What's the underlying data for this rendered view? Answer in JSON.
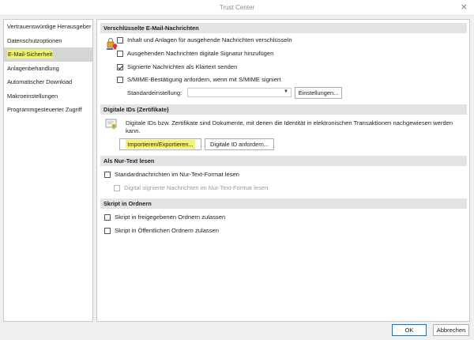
{
  "window": {
    "title": "Trust Center",
    "close_glyph": "×"
  },
  "sidebar": {
    "items": [
      {
        "label": "Vertrauenswürdige Herausgeber"
      },
      {
        "label": "Datenschutzoptionen"
      },
      {
        "label": "E-Mail-Sicherheit"
      },
      {
        "label": "Anlagenbehandlung"
      },
      {
        "label": "Automatischer Download"
      },
      {
        "label": "Makroeinstellungen"
      },
      {
        "label": "Programmgesteuerter Zugriff"
      }
    ],
    "selected_index": 2
  },
  "encrypted": {
    "header": "Verschlüsselte E-Mail-Nachrichten",
    "icon": "lock-certificate-icon",
    "options": [
      {
        "label": "Inhalt und Anlagen für ausgehende Nachrichten verschlüsseln",
        "checked": false
      },
      {
        "label": "Ausgehenden Nachrichten digitale Signatur hinzufügen",
        "checked": false
      },
      {
        "label": "Signierte Nachrichten als Klartext senden",
        "checked": true
      },
      {
        "label": "S/MIME-Bestätigung anfordern, wenn mit S/MIME signiert",
        "checked": false
      }
    ],
    "default_setting_label": "Standardeinstellung:",
    "default_setting_value": "",
    "settings_button": "Einstellungen..."
  },
  "digital_ids": {
    "header": "Digitale IDs (Zertifikate)",
    "icon": "certificate-icon",
    "description": "Digitale IDs bzw. Zertifikate sind Dokumente, mit denen die Identität in elektronischen Transaktionen nachgewiesen werden kann.",
    "import_button": "Importieren/Exportieren...",
    "request_button": "Digitale ID anfordern..."
  },
  "plain_text": {
    "header": "Als Nur-Text lesen",
    "options": [
      {
        "label": "Standardnachrichten im Nur-Text-Format lesen",
        "checked": false,
        "disabled": false
      },
      {
        "label": "Digital signierte Nachrichten im Nur-Text-Format lesen",
        "checked": false,
        "disabled": true
      }
    ]
  },
  "scripts": {
    "header": "Skript in Ordnern",
    "options": [
      {
        "label": "Skript in freigegebenen Ordnern zulassen",
        "checked": false
      },
      {
        "label": "Skript in Öffentlichen Ordnern zulassen",
        "checked": false
      }
    ]
  },
  "footer": {
    "ok": "OK",
    "cancel": "Abbrechen"
  },
  "colors": {
    "highlight": "#f4f36a",
    "selected_bg": "#d5d5d5",
    "section_bg": "#e3e3e3"
  }
}
